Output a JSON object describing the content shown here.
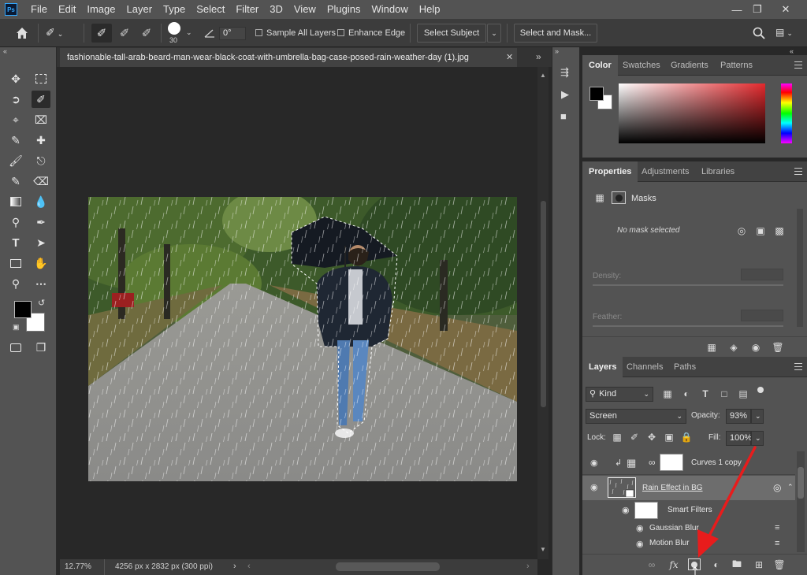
{
  "menu": {
    "app_logo": "Ps",
    "items": [
      "File",
      "Edit",
      "Image",
      "Layer",
      "Type",
      "Select",
      "Filter",
      "3D",
      "View",
      "Plugins",
      "Window",
      "Help"
    ]
  },
  "options": {
    "brush_size": "30",
    "angle": "0°",
    "sample_all_layers": "Sample All Layers",
    "enhance_edge": "Enhance Edge",
    "select_subject": "Select Subject",
    "select_and_mask": "Select and Mask..."
  },
  "document": {
    "tab_title": "fashionable-tall-arab-beard-man-wear-black-coat-with-umbrella-bag-case-posed-rain-weather-day (1).jpg",
    "zoom": "12.77%",
    "dimensions": "4256 px x 2832 px (300 ppi)"
  },
  "color_panel": {
    "tabs": [
      "Color",
      "Swatches",
      "Gradients",
      "Patterns"
    ],
    "foreground": "#000000",
    "background": "#ffffff",
    "hue_color": "#e3292d"
  },
  "properties_panel": {
    "tabs": [
      "Properties",
      "Adjustments",
      "Libraries"
    ],
    "section": "Masks",
    "status": "No mask selected",
    "density_label": "Density:",
    "feather_label": "Feather:"
  },
  "layers_panel": {
    "tabs": [
      "Layers",
      "Channels",
      "Paths"
    ],
    "filter_kind": "Kind",
    "blend_mode": "Screen",
    "opacity_label": "Opacity:",
    "opacity": "93%",
    "lock_label": "Lock:",
    "fill_label": "Fill:",
    "fill": "100%",
    "layers": [
      {
        "name": "Curves 1 copy"
      },
      {
        "name": "Rain Effect in BG"
      },
      {
        "name": "Smart Filters"
      },
      {
        "name": "Gaussian Blur"
      },
      {
        "name": "Motion Blur"
      }
    ]
  },
  "annotation": {
    "arrow_color": "#e81c1c"
  }
}
